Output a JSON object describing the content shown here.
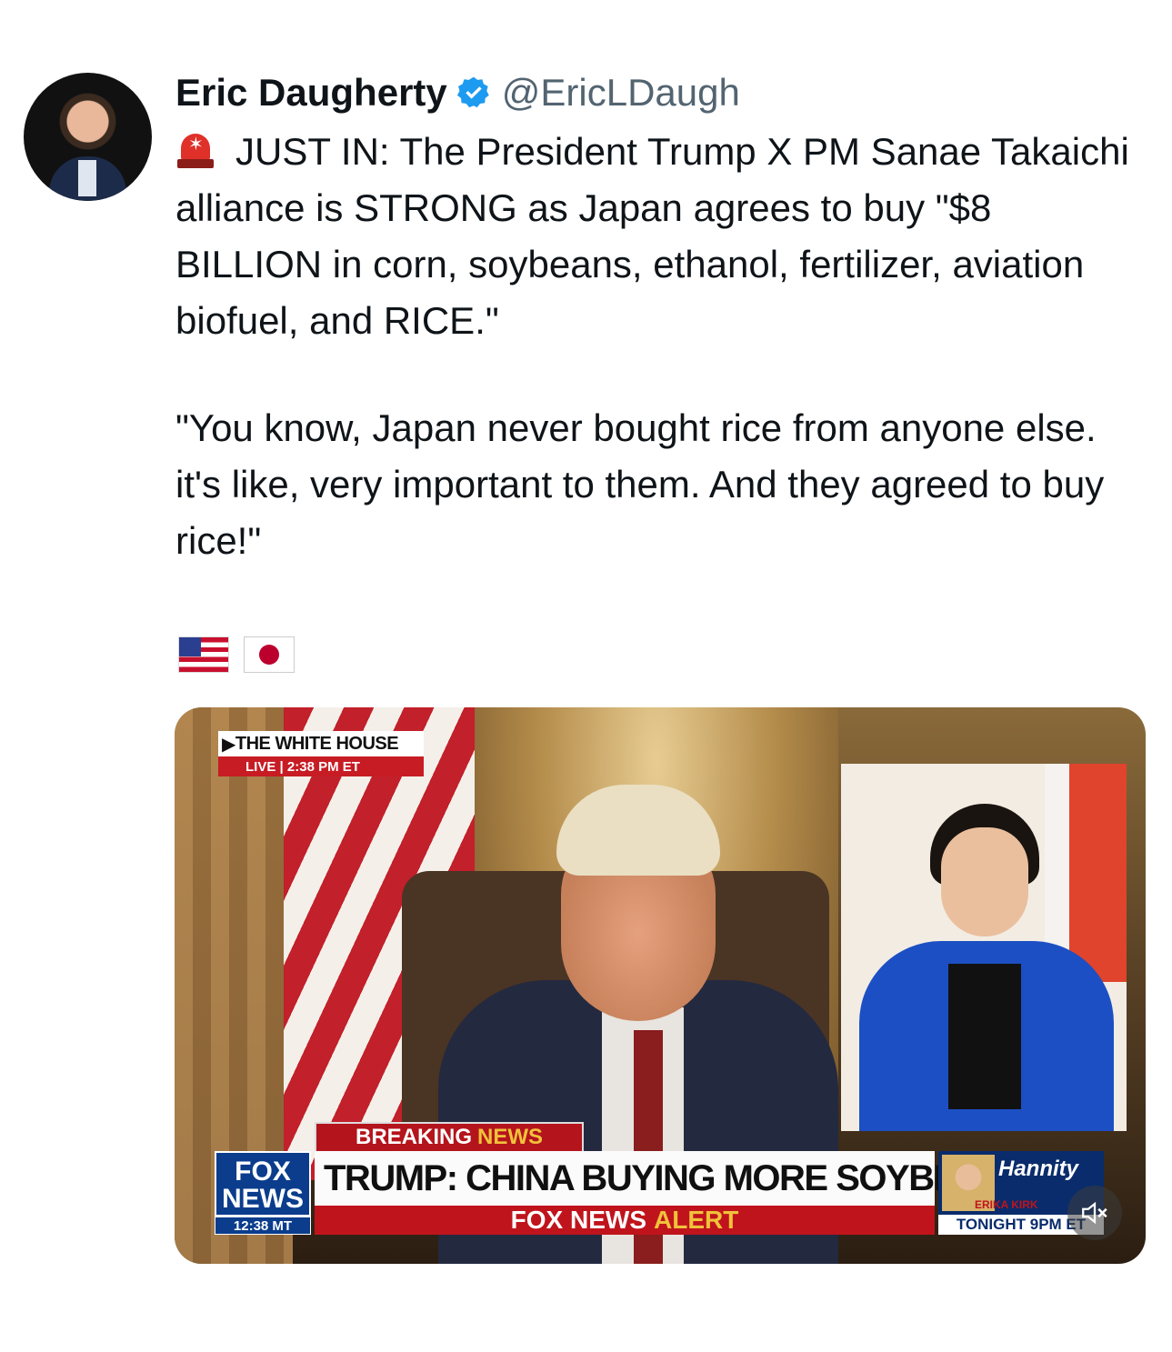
{
  "author": {
    "name": "Eric Daugherty",
    "handle": "@EricLDaugh",
    "verified": true,
    "verified_color": "#1d9bf0"
  },
  "tweet": {
    "line1": "JUST IN: The President Trump X PM Sanae Takaichi alliance is STRONG as Japan agrees to buy \"$8 BILLION in corn, soybeans, ethanol, fertilizer, aviation biofuel, and RICE.\"",
    "quote": "\"You know, Japan never bought rice from anyone else. it's like, very important to them. And they agreed to buy rice!\"",
    "emoji": [
      "siren-icon",
      "us-flag-icon",
      "japan-flag-icon"
    ]
  },
  "video": {
    "live_bug_title": "THE WHITE HOUSE",
    "live_label": "LIVE",
    "live_time": "2:38 PM ET",
    "breaking": "BREAKING",
    "breaking_news": "NEWS",
    "network_line1": "FOX",
    "network_line2": "NEWS",
    "network_time": "12:38 MT",
    "headline": "TRUMP: CHINA BUYING MORE SOYBEANS",
    "alert_prefix": "FOX NEWS",
    "alert_word": "ALERT",
    "promo_show": "Hannity",
    "promo_guest": "ERIKA KIRK",
    "promo_time": "TONIGHT 9PM ET",
    "muted": true
  }
}
